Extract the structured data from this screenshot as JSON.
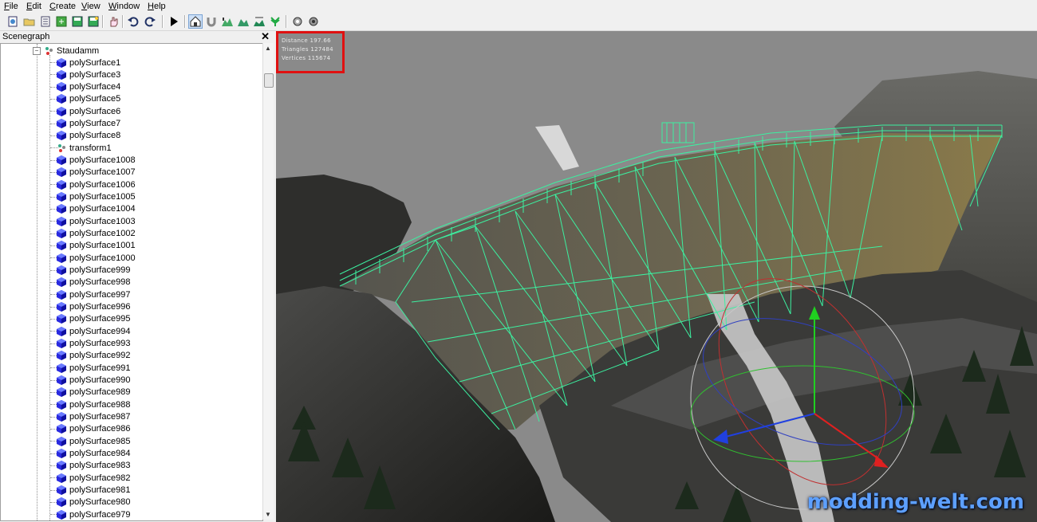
{
  "menu": [
    {
      "label": "File",
      "mnemonic": "F"
    },
    {
      "label": "Edit",
      "mnemonic": "E"
    },
    {
      "label": "Create",
      "mnemonic": "C"
    },
    {
      "label": "View",
      "mnemonic": "V"
    },
    {
      "label": "Window",
      "mnemonic": "W"
    },
    {
      "label": "Help",
      "mnemonic": "H"
    }
  ],
  "toolbar": {
    "icons": [
      "new-scene-icon",
      "open-icon",
      "list-icon",
      "export-icon",
      "save-icon",
      "save-as-icon",
      "hand-icon",
      "undo-icon",
      "redo-icon",
      "play-icon",
      "home-view-icon",
      "magnet-icon",
      "terrain-icon",
      "terrain-raise-icon",
      "terrain-smooth-icon",
      "foliage-icon",
      "settings-icon",
      "render-settings-icon"
    ],
    "active_icon": "home-view-icon"
  },
  "scenegraph": {
    "title": "Scenegraph",
    "close_label": "✕",
    "root": "Staudamm",
    "items": [
      {
        "label": "polySurface1",
        "type": "mesh"
      },
      {
        "label": "polySurface3",
        "type": "mesh"
      },
      {
        "label": "polySurface4",
        "type": "mesh"
      },
      {
        "label": "polySurface5",
        "type": "mesh"
      },
      {
        "label": "polySurface6",
        "type": "mesh"
      },
      {
        "label": "polySurface7",
        "type": "mesh"
      },
      {
        "label": "polySurface8",
        "type": "mesh"
      },
      {
        "label": "transform1",
        "type": "transform"
      },
      {
        "label": "polySurface1008",
        "type": "mesh"
      },
      {
        "label": "polySurface1007",
        "type": "mesh"
      },
      {
        "label": "polySurface1006",
        "type": "mesh"
      },
      {
        "label": "polySurface1005",
        "type": "mesh"
      },
      {
        "label": "polySurface1004",
        "type": "mesh"
      },
      {
        "label": "polySurface1003",
        "type": "mesh"
      },
      {
        "label": "polySurface1002",
        "type": "mesh"
      },
      {
        "label": "polySurface1001",
        "type": "mesh"
      },
      {
        "label": "polySurface1000",
        "type": "mesh"
      },
      {
        "label": "polySurface999",
        "type": "mesh"
      },
      {
        "label": "polySurface998",
        "type": "mesh"
      },
      {
        "label": "polySurface997",
        "type": "mesh"
      },
      {
        "label": "polySurface996",
        "type": "mesh"
      },
      {
        "label": "polySurface995",
        "type": "mesh"
      },
      {
        "label": "polySurface994",
        "type": "mesh"
      },
      {
        "label": "polySurface993",
        "type": "mesh"
      },
      {
        "label": "polySurface992",
        "type": "mesh"
      },
      {
        "label": "polySurface991",
        "type": "mesh"
      },
      {
        "label": "polySurface990",
        "type": "mesh"
      },
      {
        "label": "polySurface989",
        "type": "mesh"
      },
      {
        "label": "polySurface988",
        "type": "mesh"
      },
      {
        "label": "polySurface987",
        "type": "mesh"
      },
      {
        "label": "polySurface986",
        "type": "mesh"
      },
      {
        "label": "polySurface985",
        "type": "mesh"
      },
      {
        "label": "polySurface984",
        "type": "mesh"
      },
      {
        "label": "polySurface983",
        "type": "mesh"
      },
      {
        "label": "polySurface982",
        "type": "mesh"
      },
      {
        "label": "polySurface981",
        "type": "mesh"
      },
      {
        "label": "polySurface980",
        "type": "mesh"
      },
      {
        "label": "polySurface979",
        "type": "mesh"
      }
    ]
  },
  "viewport": {
    "stats": {
      "distance": "Distance 197.66",
      "triangles": "Triangles 127484",
      "vertices": "Vertices 115674"
    },
    "watermark": "modding-welt.com",
    "colors": {
      "wireframe": "#3cf0a0",
      "sky": "#888888",
      "gizmo_x": "#e02020",
      "gizmo_y": "#20c020",
      "gizmo_z": "#2040e0",
      "stats_border": "#e01010"
    }
  }
}
